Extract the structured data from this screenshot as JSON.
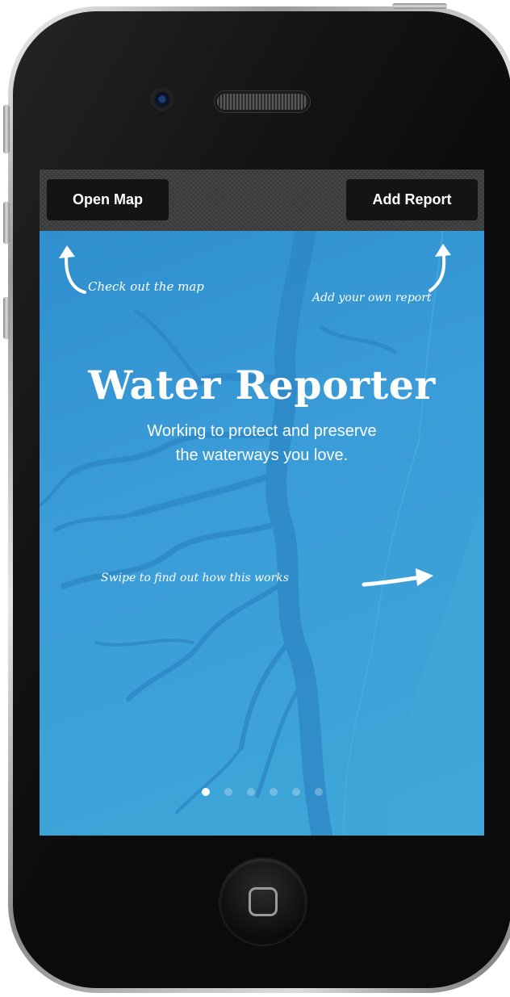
{
  "topbar": {
    "open_map_label": "Open Map",
    "add_report_label": "Add Report"
  },
  "hints": {
    "map_hint": "Check out the map",
    "report_hint": "Add your own report",
    "swipe_hint": "Swipe to find out how this works"
  },
  "hero": {
    "title": "Water Reporter",
    "tagline_line1": "Working to protect and preserve",
    "tagline_line2": "the waterways you love."
  },
  "pager": {
    "total_pages": 6,
    "current_page": 1
  },
  "colors": {
    "screen_blue": "#3a9ad6",
    "bar_dark": "#3b3b3b",
    "button_black": "#141414",
    "text_white": "#ffffff"
  },
  "icons": {
    "hint_arrows": [
      "curved-arrow-up-left-icon",
      "curved-arrow-up-right-icon",
      "arrow-right-icon"
    ],
    "home": "home-button-icon"
  }
}
